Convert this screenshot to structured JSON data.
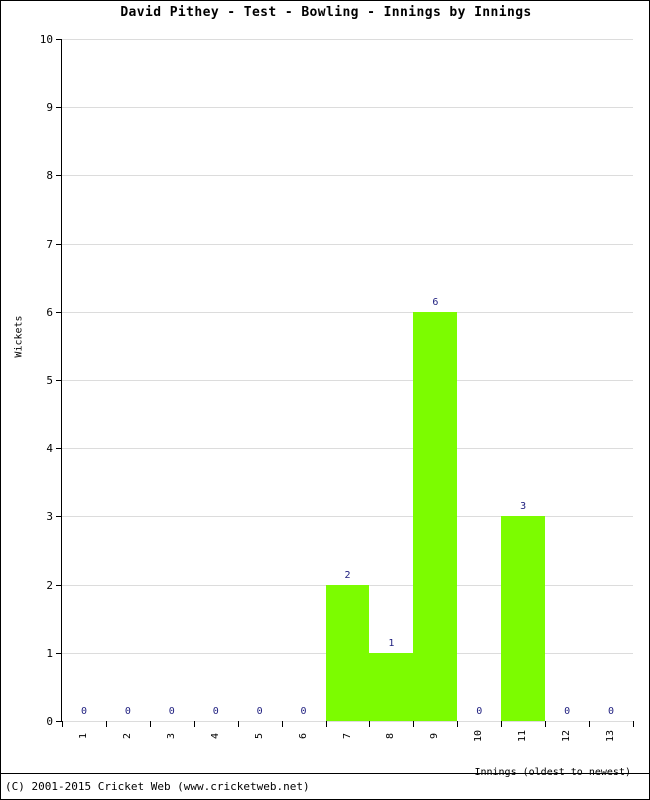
{
  "chart_data": {
    "type": "bar",
    "title": "David Pithey - Test - Bowling - Innings by Innings",
    "xlabel": "Innings (oldest to newest)",
    "ylabel": "Wickets",
    "categories": [
      "1",
      "2",
      "3",
      "4",
      "5",
      "6",
      "7",
      "8",
      "9",
      "10",
      "11",
      "12",
      "13"
    ],
    "values": [
      0,
      0,
      0,
      0,
      0,
      0,
      2,
      1,
      6,
      0,
      3,
      0,
      0
    ],
    "point_labels": [
      "0",
      "0",
      "0",
      "0",
      "0",
      "0",
      "2",
      "1",
      "6",
      "0",
      "3",
      "0",
      "0"
    ],
    "ylim": [
      0,
      10
    ],
    "ytick_labels": [
      "0",
      "1",
      "2",
      "3",
      "4",
      "5",
      "6",
      "7",
      "8",
      "9",
      "10"
    ],
    "ytick_values": [
      0,
      1,
      2,
      3,
      4,
      5,
      6,
      7,
      8,
      9,
      10
    ],
    "grid": true,
    "legend": "none",
    "bar_color": "#7CFC00",
    "label_color": "#202080",
    "grid_color": "#DCDCDC",
    "axis_color": "#000000"
  },
  "footer": {
    "copyright": "(C) 2001-2015 Cricket Web (www.cricketweb.net)"
  }
}
